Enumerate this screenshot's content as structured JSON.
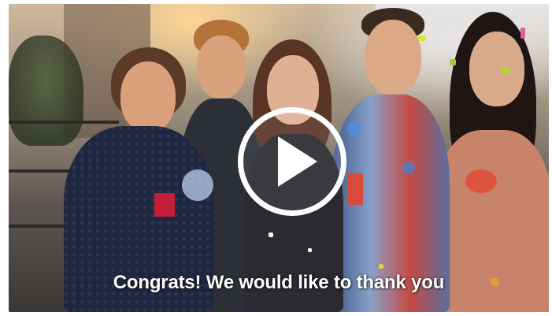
{
  "video": {
    "caption": "Congrats! We would like to thank you",
    "play_icon": "play-icon"
  },
  "colors": {
    "caption": "#ffffff",
    "play_button_outline": "#ffffff",
    "frame_background": "#ffffff"
  }
}
